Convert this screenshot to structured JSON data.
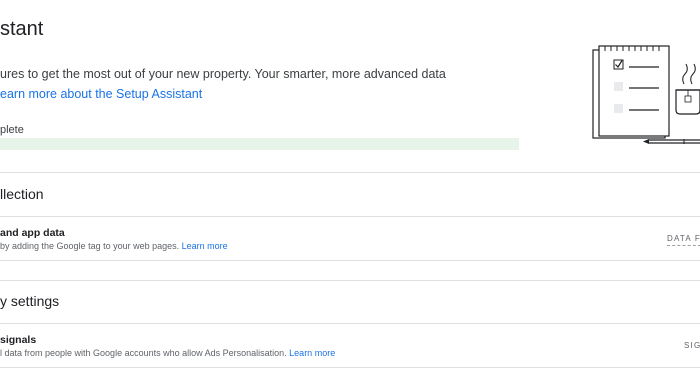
{
  "header": {
    "title": "stant",
    "subtitle": "ures to get the most out of your new property. Your smarter, more advanced data",
    "learn_more_link": "earn more about the Setup Assistant"
  },
  "progress": {
    "label": "plete",
    "fraction": 0
  },
  "sections": {
    "collection": {
      "title": "llection",
      "row": {
        "title": "and app data",
        "description": "by adding the Google tag to your web pages. ",
        "link": "Learn more",
        "action": "DATA F"
      }
    },
    "settings": {
      "title": "y settings",
      "row": {
        "title": "signals",
        "description": "l data from people with Google accounts who allow Ads Personalisation. ",
        "link": "Learn more",
        "action": "SIG"
      }
    }
  },
  "colors": {
    "accent_link": "#1a73e8",
    "progress_track": "#e6f4ea",
    "divider": "#e0e0e0"
  },
  "icons": [
    "checklist-illustration-icon",
    "coffee-mug-icon",
    "pen-icon"
  ]
}
